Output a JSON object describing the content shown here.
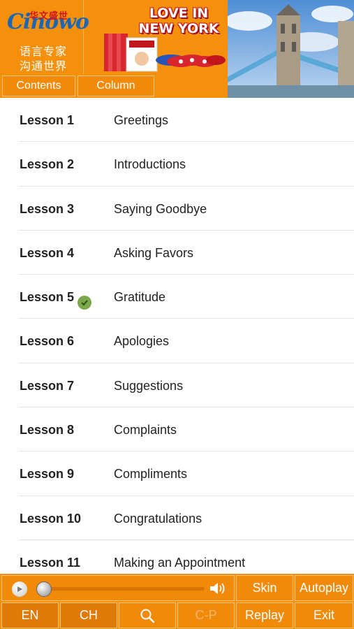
{
  "header": {
    "logo_cn": "华文盛世",
    "logo_latin": "Cinowo",
    "tagline_1": "语言专家",
    "tagline_2": "沟通世界",
    "banner_title": "LOVE IN NEW YORK",
    "tabs": [
      {
        "label": "Contents"
      },
      {
        "label": "Column"
      }
    ]
  },
  "lessons": [
    {
      "number": "Lesson 1",
      "title": "Greetings"
    },
    {
      "number": "Lesson 2",
      "title": "Introductions"
    },
    {
      "number": "Lesson 3",
      "title": "Saying Goodbye"
    },
    {
      "number": "Lesson 4",
      "title": "Asking Favors"
    },
    {
      "number": "Lesson 5",
      "title": "Gratitude",
      "checked": true
    },
    {
      "number": "Lesson 6",
      "title": "Apologies"
    },
    {
      "number": "Lesson 7",
      "title": "Suggestions"
    },
    {
      "number": "Lesson 8",
      "title": "Complaints"
    },
    {
      "number": "Lesson 9",
      "title": "Compliments"
    },
    {
      "number": "Lesson 10",
      "title": "Congratulations"
    },
    {
      "number": "Lesson 11",
      "title": "Making an Appointment"
    }
  ],
  "controls": {
    "skin_label": "Skin",
    "autoplay_label": "Autoplay",
    "en_label": "EN",
    "ch_label": "CH",
    "cp_label": "C-P",
    "replay_label": "Replay",
    "exit_label": "Exit",
    "progress": 0.0
  },
  "colors": {
    "accent": "#f5900c",
    "check": "#7aa84a"
  }
}
